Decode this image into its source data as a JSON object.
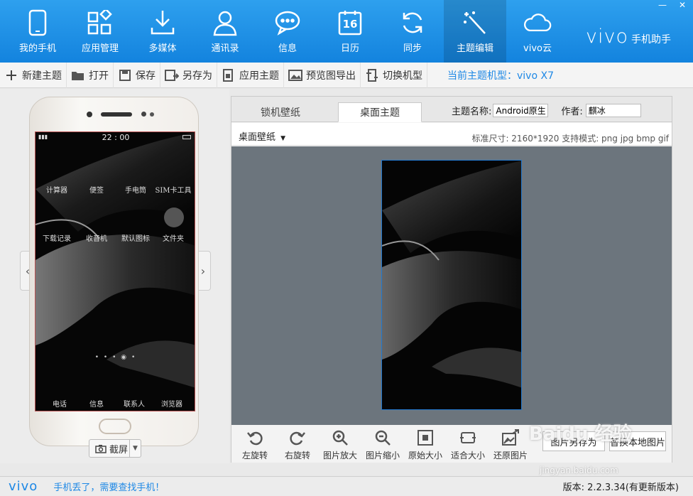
{
  "colors": {
    "accent": "#1383de",
    "link": "#1e88e5",
    "canvas": "#6c757d"
  },
  "window": {
    "min": "—",
    "close": "✕"
  },
  "nav": [
    {
      "label": "我的手机",
      "icon": "phone-icon"
    },
    {
      "label": "应用管理",
      "icon": "apps-grid-icon"
    },
    {
      "label": "多媒体",
      "icon": "download-icon"
    },
    {
      "label": "通讯录",
      "icon": "contact-person-icon"
    },
    {
      "label": "信息",
      "icon": "message-bubble-icon"
    },
    {
      "label": "日历",
      "icon": "calendar-icon",
      "day": "16"
    },
    {
      "label": "同步",
      "icon": "sync-icon"
    },
    {
      "label": "主题编辑",
      "icon": "magic-wand-icon",
      "active": true
    },
    {
      "label": "vivo云",
      "icon": "cloud-icon"
    }
  ],
  "brand": {
    "logo": "vivo",
    "app": "手机助手"
  },
  "toolbar": {
    "items": [
      {
        "label": "新建主题",
        "icon": "plus-icon"
      },
      {
        "label": "打开",
        "icon": "folder-icon"
      },
      {
        "label": "保存",
        "icon": "save-icon"
      },
      {
        "label": "另存为",
        "icon": "save-as-icon"
      },
      {
        "label": "应用主题",
        "icon": "apply-theme-icon"
      },
      {
        "label": "预览图导出",
        "icon": "image-export-icon"
      },
      {
        "label": "切换机型",
        "icon": "switch-device-icon"
      }
    ],
    "current_model": "当前主题机型：vivo X7"
  },
  "phone": {
    "status_time": "22 : 00",
    "apps_row1": [
      "计算器",
      "便签",
      "手电筒",
      "SIM卡工具"
    ],
    "apps_row2": [
      "下载记录",
      "收音机",
      "默认图标",
      "文件夹"
    ],
    "dock": [
      "电话",
      "信息",
      "联系人",
      "浏览器"
    ],
    "screenshot_label": "截屏"
  },
  "editor": {
    "tabs": [
      "锁机壁纸",
      "桌面主题"
    ],
    "active_tab": 1,
    "theme_name_label": "主题名称:",
    "theme_name_value": "Android原生",
    "author_label": "作者:",
    "author_value": "麒冰",
    "wallpaper_dropdown": "桌面壁纸",
    "spec_text": "标准尺寸: 2160*1920 支持模式: png jpg bmp gif"
  },
  "tools": [
    {
      "label": "左旋转",
      "icon": "rotate-left-icon"
    },
    {
      "label": "右旋转",
      "icon": "rotate-right-icon"
    },
    {
      "label": "图片放大",
      "icon": "zoom-in-icon"
    },
    {
      "label": "图片缩小",
      "icon": "zoom-out-icon"
    },
    {
      "label": "原始大小",
      "icon": "original-size-icon"
    },
    {
      "label": "适合大小",
      "icon": "fit-size-icon"
    },
    {
      "label": "还原图片",
      "icon": "restore-image-icon"
    }
  ],
  "actions": {
    "save_image_as": "图片另存为",
    "replace_image": "替换本地图片"
  },
  "status": {
    "logo": "vivo",
    "lost_phone": "手机丢了，需要查找手机！",
    "version": "版本: 2.2.3.34(有更新版本)"
  },
  "watermark": {
    "text": "Baidu 经验",
    "url": "jingyan.baidu.com"
  }
}
